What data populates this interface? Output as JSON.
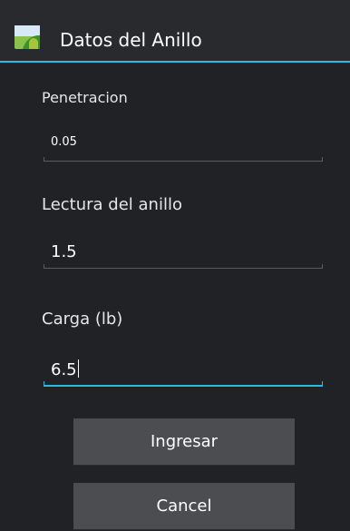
{
  "dialog": {
    "title": "Datos del Anillo",
    "icon": "android-app-icon"
  },
  "fields": [
    {
      "label": "Penetracion",
      "value": "0.05"
    },
    {
      "label": "Lectura del anillo",
      "value": "1.5"
    },
    {
      "label": "Carga (lb)",
      "value": "6.5"
    }
  ],
  "buttons": {
    "submit_label": "Ingresar",
    "cancel_label": "Cancel"
  },
  "colors": {
    "accent": "#33b5e5",
    "background": "#202226",
    "button": "#4b4d51"
  }
}
